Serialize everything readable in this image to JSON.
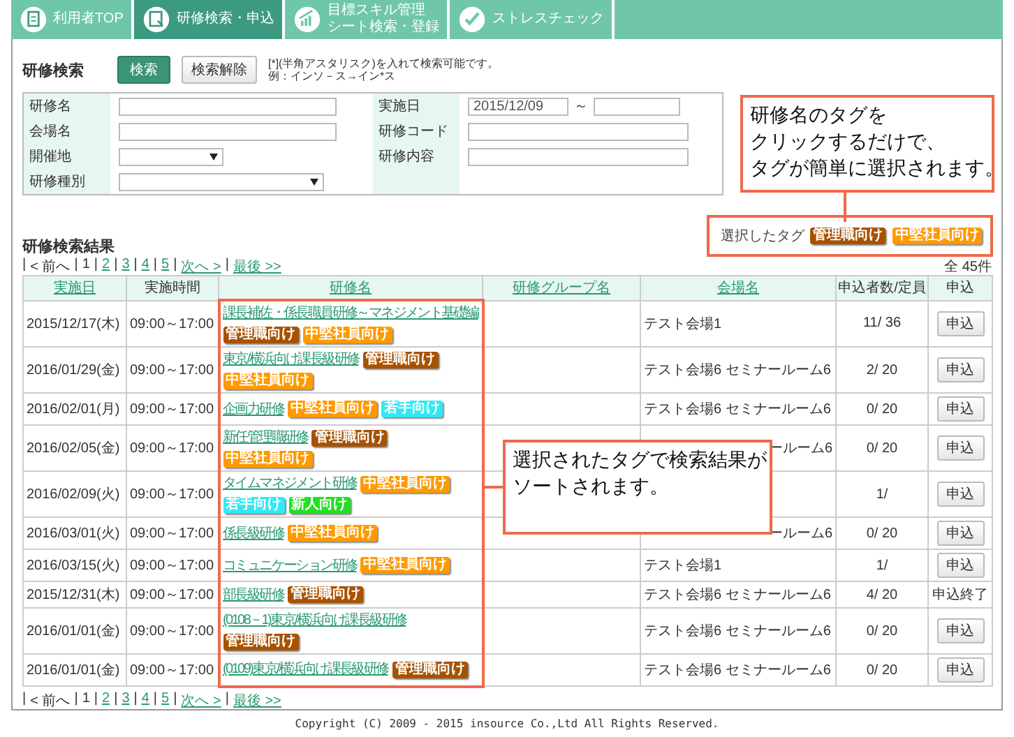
{
  "tabs": [
    {
      "lines": [
        "利用者TOP"
      ],
      "selected": false
    },
    {
      "lines": [
        "研修検索・申込"
      ],
      "selected": true
    },
    {
      "lines": [
        "目標スキル管理",
        "シート検索・登録"
      ],
      "selected": false
    },
    {
      "lines": [
        "ストレスチェック"
      ],
      "selected": false
    }
  ],
  "search": {
    "title": "研修検索",
    "search_button": "検索",
    "clear_button": "検索解除",
    "note": [
      "[*](半角アスタリスク)を入れて検索可能です。",
      "例：インソ－ス→イン*ス"
    ],
    "left_fields": [
      {
        "label": "研修名",
        "kind": "text"
      },
      {
        "label": "会場名",
        "kind": "text"
      },
      {
        "label": "開催地",
        "kind": "select"
      },
      {
        "label": "研修種別",
        "kind": "select"
      }
    ],
    "right_fields": [
      {
        "label": "実施日",
        "kind": "daterange",
        "value": "2015/12/09",
        "separator": "～"
      },
      {
        "label": "研修コード",
        "kind": "text"
      },
      {
        "label": "研修内容",
        "kind": "text"
      }
    ]
  },
  "results": {
    "title": "研修検索結果",
    "selected_tags_label": "選択したタグ",
    "selected_tags": [
      {
        "label": "管理職向け",
        "color": "#a85200"
      },
      {
        "label": "中堅社員向け",
        "color": "#ff9a00"
      }
    ],
    "count": "全 45件",
    "pagination_top": {
      "separator": "|",
      "items": [
        {
          "label": "< 前へ",
          "link": false
        },
        {
          "label": "1",
          "link": false
        },
        {
          "label": "2",
          "link": true
        },
        {
          "label": "3",
          "link": true
        },
        {
          "label": "4",
          "link": true
        },
        {
          "label": "5",
          "link": true
        },
        {
          "label": "次へ >",
          "link": true
        },
        {
          "label": "最後 >>",
          "link": true
        }
      ]
    },
    "pagination_bottom": {
      "separator": "|",
      "items": [
        {
          "label": "< 前へ",
          "link": false
        },
        {
          "label": "1",
          "link": false
        },
        {
          "label": "2",
          "link": true
        },
        {
          "label": "3",
          "link": true
        },
        {
          "label": "4",
          "link": true
        },
        {
          "label": "5",
          "link": true
        },
        {
          "label": "次へ >",
          "link": true
        },
        {
          "label": "最後 >>",
          "link": true
        }
      ]
    },
    "columns": [
      {
        "label": "実施日",
        "link": true
      },
      {
        "label": "実施時間",
        "link": false
      },
      {
        "label": "研修名",
        "link": true
      },
      {
        "label": "研修グループ名",
        "link": true
      },
      {
        "label": "会場名",
        "link": true
      },
      {
        "label": "申込者数/定員",
        "link": false
      },
      {
        "label": "申込",
        "link": false
      }
    ],
    "rows": [
      {
        "date": "2015/12/17(木)",
        "time": "09:00～17:00",
        "name": "課長補佐・係長職員研修～マネジメント基礎編",
        "tags": [
          {
            "label": "管理職向け",
            "color": "#a85200"
          },
          {
            "label": "中堅社員向け",
            "color": "#ff9a00"
          }
        ],
        "venue": "テスト会場1",
        "count": "11/ 36",
        "apply": {
          "kind": "button",
          "label": "申込"
        }
      },
      {
        "date": "2016/01/29(金)",
        "time": "09:00～17:00",
        "name": "東京/横浜向け課長級研修",
        "tags": [
          {
            "label": "管理職向け",
            "color": "#a85200"
          },
          {
            "label": "中堅社員向け",
            "color": "#ff9a00"
          }
        ],
        "venue": "テスト会場6 セミナールーム6",
        "count": "2/ 20",
        "apply": {
          "kind": "button",
          "label": "申込"
        }
      },
      {
        "date": "2016/02/01(月)",
        "time": "09:00～17:00",
        "name": "企画力研修",
        "tags": [
          {
            "label": "中堅社員向け",
            "color": "#ff9a00"
          },
          {
            "label": "若手向け",
            "color": "#33e8f4"
          }
        ],
        "venue": "テスト会場6 セミナールーム6",
        "count": "0/ 20",
        "apply": {
          "kind": "button",
          "label": "申込"
        }
      },
      {
        "date": "2016/02/05(金)",
        "time": "09:00～17:00",
        "name": "新任管理職研修",
        "tags": [
          {
            "label": "管理職向け",
            "color": "#a85200"
          },
          {
            "label": "中堅社員向け",
            "color": "#ff9a00"
          }
        ],
        "venue": "ールーム6",
        "venue_covered": true,
        "count": "0/ 20",
        "apply": {
          "kind": "button",
          "label": "申込"
        }
      },
      {
        "date": "2016/02/09(火)",
        "time": "09:00～17:00",
        "name": "タイムマネジメント研修",
        "tags": [
          {
            "label": "中堅社員向け",
            "color": "#ff9a00"
          },
          {
            "label": "若手向け",
            "color": "#33e8f4"
          },
          {
            "label": "新人向け",
            "color": "#22e022"
          }
        ],
        "count": "1/",
        "apply": {
          "kind": "button",
          "label": "申込"
        }
      },
      {
        "date": "2016/03/01(火)",
        "time": "09:00～17:00",
        "name": "係長級研修",
        "tags": [
          {
            "label": "中堅社員向け",
            "color": "#ff9a00"
          }
        ],
        "venue": "ールーム6",
        "venue_covered": true,
        "count": "0/ 20",
        "apply": {
          "kind": "button",
          "label": "申込"
        }
      },
      {
        "date": "2016/03/15(火)",
        "time": "09:00～17:00",
        "name": "コミュニケーション研修",
        "tags": [
          {
            "label": "中堅社員向け",
            "color": "#ff9a00"
          }
        ],
        "venue": "テスト会場1",
        "count": "1/",
        "apply": {
          "kind": "button",
          "label": "申込"
        }
      },
      {
        "date": "2015/12/31(木)",
        "time": "09:00～17:00",
        "name": "部長級研修",
        "tags": [
          {
            "label": "管理職向け",
            "color": "#a85200"
          }
        ],
        "venue": "テスト会場6 セミナールーム6",
        "count": "4/ 20",
        "apply": {
          "kind": "closed",
          "label": "申込終了"
        }
      },
      {
        "date": "2016/01/01(金)",
        "time": "09:00～17:00",
        "name": "(0108－1)東京/横浜向け課長級研修",
        "tags": [
          {
            "label": "管理職向け",
            "color": "#a85200"
          }
        ],
        "venue": "テスト会場6 セミナールーム6",
        "count": "0/ 20",
        "apply": {
          "kind": "button",
          "label": "申込"
        }
      },
      {
        "date": "2016/01/01(金)",
        "time": "09:00～17:00",
        "name": "(0109)東京/横浜向け課長級研修",
        "tags": [
          {
            "label": "管理職向け",
            "color": "#a85200"
          }
        ],
        "venue": "テスト会場6 セミナールーム6",
        "count": "0/ 20",
        "apply": {
          "kind": "button",
          "label": "申込"
        }
      }
    ]
  },
  "callouts": [
    {
      "lines": [
        "研修名のタグを",
        "クリックするだけで、",
        "タグが簡単に選択されます。"
      ]
    },
    {
      "lines": [
        "選択されたタグで検索結果が",
        "ソートされます。"
      ]
    }
  ],
  "footer": "Copyright (C) 2009 - 2015 insource Co.,Ltd All Rights Reserved."
}
